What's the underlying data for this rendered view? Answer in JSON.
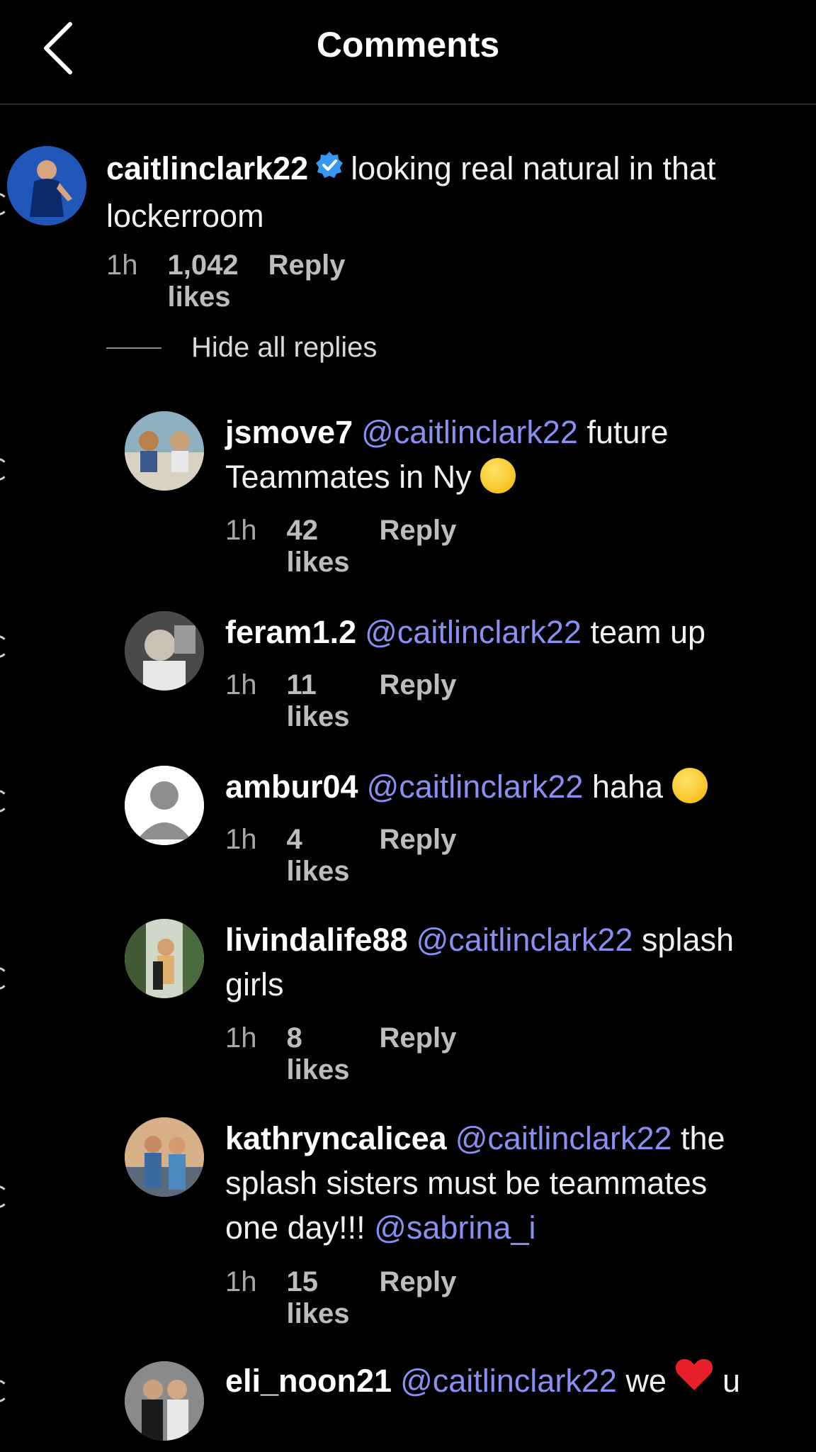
{
  "header": {
    "title": "Comments"
  },
  "main_comment": {
    "username": "caitlinclark22",
    "text": "looking real natural in that lockerroom",
    "time": "1h",
    "likes": "1,042 likes",
    "reply": "Reply"
  },
  "hide_replies": "Hide all replies",
  "replies": [
    {
      "username": "jsmove7",
      "mention": "@caitlinclark22",
      "text": "future Teammates in Ny",
      "emoji": "thinking-face-emoji",
      "time": "1h",
      "likes": "42 likes",
      "reply": "Reply"
    },
    {
      "username": "feram1.2",
      "mention": "@caitlinclark22",
      "text": "team up",
      "time": "1h",
      "likes": "11 likes",
      "reply": "Reply"
    },
    {
      "username": "ambur04",
      "mention": "@caitlinclark22",
      "text": "haha",
      "emoji": "rolling-laughing-emoji",
      "time": "1h",
      "likes": "4 likes",
      "reply": "Reply"
    },
    {
      "username": "livindalife88",
      "mention": "@caitlinclark22",
      "text": "splash girls",
      "time": "1h",
      "likes": "8 likes",
      "reply": "Reply"
    },
    {
      "username": "kathryncalicea",
      "mention": "@caitlinclark22",
      "text": "the splash sisters must be teammates one day!!!",
      "mention2": "@sabrina_i",
      "time": "1h",
      "likes": "15 likes",
      "reply": "Reply"
    },
    {
      "username": "eli_noon21",
      "mention": "@caitlinclark22",
      "text": "we",
      "text2": "u",
      "emoji": "red-heart-emoji"
    }
  ],
  "colors": {
    "background": "#000000",
    "mention": "#8a8ff2",
    "verified": "#3897f0",
    "meta": "#a8a8a8"
  }
}
